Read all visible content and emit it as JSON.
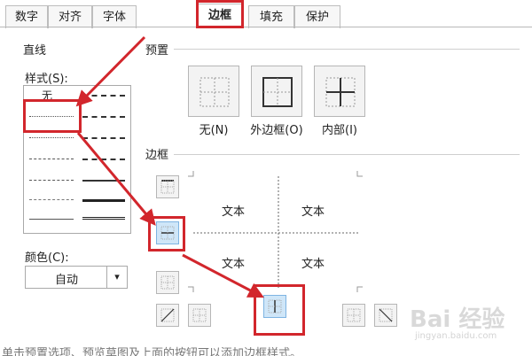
{
  "tabs": [
    "数字",
    "对齐",
    "字体",
    "边框",
    "填充",
    "保护"
  ],
  "active_tab": "边框",
  "line_section": {
    "title": "直线",
    "style_label": "样式(S):",
    "none_label": "无",
    "color_label": "颜色(C):",
    "color_value": "自动"
  },
  "presets": {
    "title": "预置",
    "items": [
      {
        "label": "无(N)"
      },
      {
        "label": "外边框(O)"
      },
      {
        "label": "内部(I)"
      }
    ]
  },
  "border": {
    "title": "边框",
    "preview_text": [
      "文本",
      "文本",
      "文本",
      "文本"
    ]
  },
  "colors": {
    "highlight": "#d2262c",
    "selected_button": "#cfe6f8"
  },
  "watermark": {
    "logo": "Bai 经验",
    "url": "jingyan.baidu.com"
  },
  "bottom_text": "单击预置选项、预览草图及上面的按钮可以添加边框样式。"
}
